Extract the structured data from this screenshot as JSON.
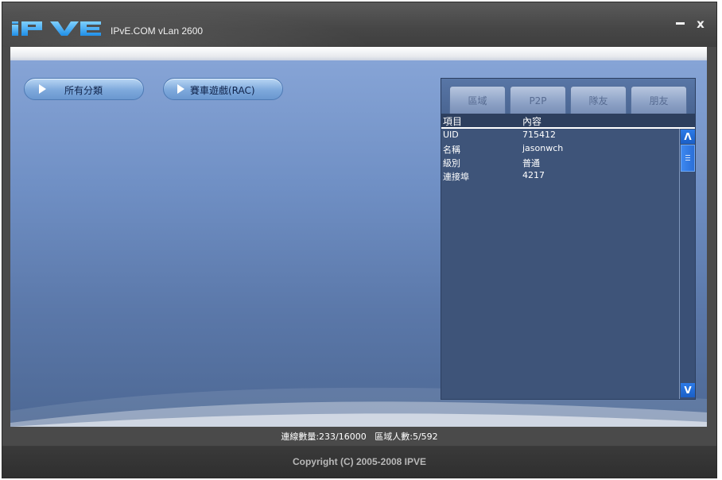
{
  "window": {
    "title": "IPvE.COM vLan 2600",
    "minimize_label": "",
    "close_label": "x"
  },
  "categories": [
    {
      "label": "所有分類"
    },
    {
      "label": "賽車遊戲(RAC)"
    }
  ],
  "panel": {
    "tabs": [
      {
        "label": "區域"
      },
      {
        "label": "P2P"
      },
      {
        "label": "隊友"
      },
      {
        "label": "朋友"
      }
    ],
    "columns": [
      "項目",
      "內容"
    ],
    "rows": [
      {
        "key": "UID",
        "value": "715412"
      },
      {
        "key": "名稱",
        "value": "jasonwch"
      },
      {
        "key": "級別",
        "value": "普通"
      },
      {
        "key": "連接埠",
        "value": "4217"
      }
    ],
    "scroll_up": "Λ",
    "scroll_down": "V"
  },
  "status": {
    "connections_label": "連線數量:",
    "connections_value": "233/16000",
    "area_label": "區域人數:",
    "area_value": "5/592"
  },
  "footer": {
    "copyright": "Copyright (C) 2005-2008 IPVE"
  },
  "colors": {
    "title_bg": "#4a4a4a",
    "main_bg": "#7392c6",
    "panel_bg": "#3e5479",
    "scrollbar_accent": "#2d7be8"
  },
  "icons": {
    "logo": "ipve-logo",
    "category_arrow": "play-arrow-icon",
    "minimize": "minimize-icon",
    "close": "close-icon"
  }
}
